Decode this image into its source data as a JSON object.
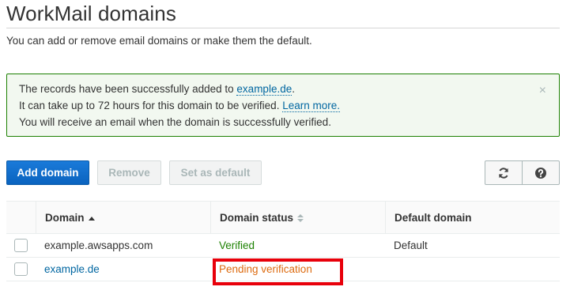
{
  "page": {
    "title": "WorkMail domains",
    "subtitle": "You can add or remove email domains or make them the default."
  },
  "flash": {
    "line1_prefix": "The records have been successfully added to ",
    "line1_link": "example.de",
    "line1_suffix": ".",
    "line2_prefix": "It can take up to 72 hours for this domain to be verified. ",
    "line2_link": "Learn more.",
    "line3": "You will receive an email when the domain is successfully verified.",
    "close_glyph": "×"
  },
  "toolbar": {
    "add_label": "Add domain",
    "remove_label": "Remove",
    "default_label": "Set as default",
    "refresh_icon": "refresh-icon",
    "help_icon": "help-icon"
  },
  "table": {
    "columns": [
      "Domain",
      "Domain status",
      "Default domain"
    ],
    "rows": [
      {
        "domain": "example.awsapps.com",
        "status": "Verified",
        "default": "Default"
      },
      {
        "domain": "example.de",
        "status": "Pending verification",
        "default": ""
      }
    ]
  },
  "colors": {
    "primary": "#0c6fd2",
    "success": "#1d8102",
    "pending": "#dd6b10",
    "link": "#0066a1",
    "highlight": "#e8000b"
  }
}
